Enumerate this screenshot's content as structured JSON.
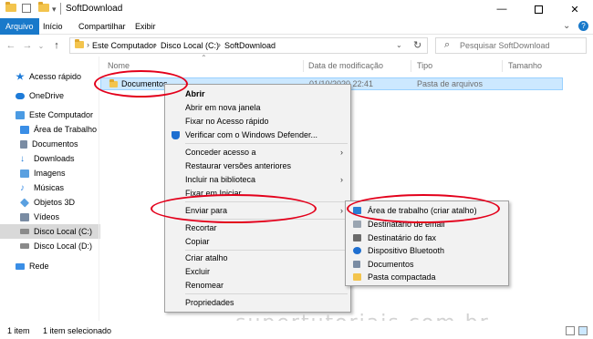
{
  "window": {
    "title": "SoftDownload",
    "minimize_icon": "minimize-icon",
    "maximize_icon": "maximize-icon",
    "close_icon": "close-icon",
    "help_icon": "help-icon",
    "expand_ribbon_icon": "chevron-down-icon"
  },
  "ribbon": {
    "tabs": [
      {
        "label": "Arquivo",
        "active": true
      },
      {
        "label": "Início",
        "active": false
      },
      {
        "label": "Compartilhar",
        "active": false
      },
      {
        "label": "Exibir",
        "active": false
      }
    ]
  },
  "address": {
    "crumbs": [
      "Este Computador",
      "Disco Local (C:)",
      "SoftDownload"
    ],
    "search_placeholder": "Pesquisar SoftDownload"
  },
  "nav": {
    "items": [
      {
        "label": "Acesso rápido",
        "icon": "star-icon",
        "color": "#1e7bd8"
      },
      {
        "label": "OneDrive",
        "icon": "cloud-icon",
        "color": "#1e7bd8"
      },
      {
        "label": "Este Computador",
        "icon": "computer-icon",
        "color": "#4b9be3"
      },
      {
        "label": "Área de Trabalho",
        "icon": "desktop-icon",
        "color": "#3a8ee6"
      },
      {
        "label": "Documentos",
        "icon": "documents-icon",
        "color": "#7a8ca3"
      },
      {
        "label": "Downloads",
        "icon": "download-icon",
        "color": "#1e7bd8"
      },
      {
        "label": "Imagens",
        "icon": "pictures-icon",
        "color": "#5aa0e0"
      },
      {
        "label": "Músicas",
        "icon": "music-icon",
        "color": "#3a8ee6"
      },
      {
        "label": "Objetos 3D",
        "icon": "cube-icon",
        "color": "#5aa0e0"
      },
      {
        "label": "Vídeos",
        "icon": "video-icon",
        "color": "#7a8ca3"
      },
      {
        "label": "Disco Local (C:)",
        "icon": "drive-icon",
        "color": "#8a8a8a"
      },
      {
        "label": "Disco Local (D:)",
        "icon": "drive-icon",
        "color": "#8a8a8a"
      },
      {
        "label": "Rede",
        "icon": "network-icon",
        "color": "#3a8ee6"
      }
    ]
  },
  "list": {
    "columns": [
      "Nome",
      "Data de modificação",
      "Tipo",
      "Tamanho"
    ],
    "rows": [
      {
        "name": "Documentos",
        "date": "01/10/2020 22:41",
        "type": "Pasta de arquivos",
        "size": ""
      }
    ]
  },
  "context_menu": {
    "items": [
      {
        "label": "Abrir",
        "bold": true
      },
      {
        "label": "Abrir em nova janela"
      },
      {
        "label": "Fixar no Acesso rápido"
      },
      {
        "label": "Verificar com o Windows Defender...",
        "icon": "defender-icon"
      },
      {
        "label": "Conceder acesso a",
        "submenu": true
      },
      {
        "label": "Restaurar versões anteriores"
      },
      {
        "label": "Incluir na biblioteca",
        "submenu": true
      },
      {
        "label": "Fixar em Iniciar"
      },
      {
        "label": "Enviar para",
        "submenu": true
      },
      {
        "label": "Recortar"
      },
      {
        "label": "Copiar"
      },
      {
        "label": "Criar atalho"
      },
      {
        "label": "Excluir"
      },
      {
        "label": "Renomear"
      },
      {
        "label": "Propriedades"
      }
    ]
  },
  "send_to_menu": {
    "items": [
      {
        "label": "Área de trabalho (criar atalho)",
        "icon": "desktop-icon",
        "color": "#2a7fd4"
      },
      {
        "label": "Destinatário de email",
        "icon": "mail-icon",
        "color": "#9aa5b1"
      },
      {
        "label": "Destinatário do fax",
        "icon": "fax-icon",
        "color": "#6b6b6b"
      },
      {
        "label": "Dispositivo Bluetooth",
        "icon": "bluetooth-icon",
        "color": "#1e6fd0"
      },
      {
        "label": "Documentos",
        "icon": "documents-icon",
        "color": "#7a8ca3"
      },
      {
        "label": "Pasta compactada",
        "icon": "zip-folder-icon",
        "color": "#f3c44d"
      }
    ]
  },
  "status": {
    "count": "1 item",
    "selected": "1 item selecionado"
  },
  "watermark": "supertutoriais.com.br",
  "colors": {
    "accent": "#1979ca",
    "selection": "#cce8ff",
    "highlight_ring": "#e3001b",
    "folder": "#f3c44d"
  }
}
